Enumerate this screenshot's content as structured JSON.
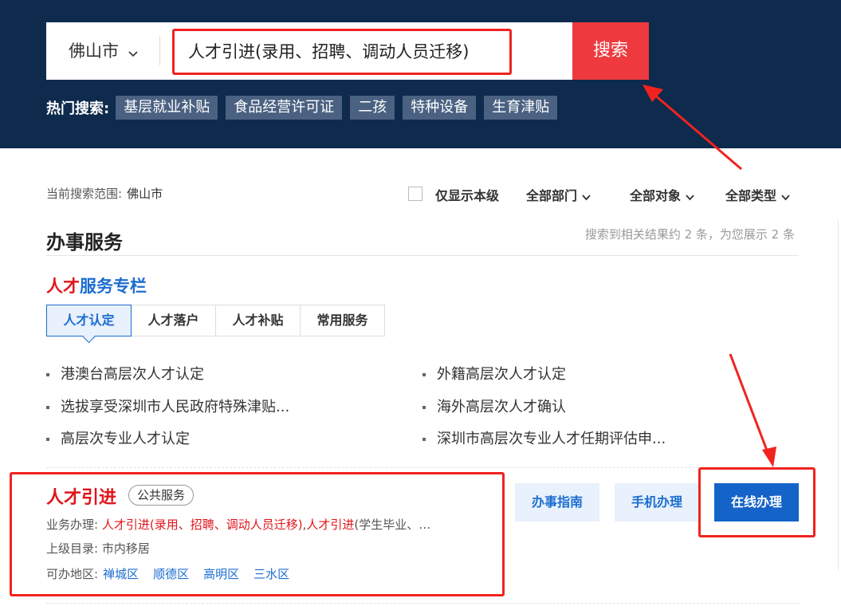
{
  "search": {
    "city": "佛山市",
    "query": "人才引进(录用、招聘、调动人员迁移)",
    "button": "搜索"
  },
  "hot": {
    "label": "热门搜索:",
    "tags": [
      "基层就业补贴",
      "食品经营许可证",
      "二孩",
      "特种设备",
      "生育津贴"
    ]
  },
  "filters": {
    "scope_label": "当前搜索范围:",
    "scope_value": "佛山市",
    "only_local": "仅显示本级",
    "dept": "全部部门",
    "target": "全部对象",
    "type": "全部类型"
  },
  "section": {
    "title": "办事服务",
    "count": "搜索到相关结果约 2 条，为您展示 2 条"
  },
  "column": {
    "title_red": "人才",
    "title_blue": "服务专栏",
    "tabs": [
      "人才认定",
      "人才落户",
      "人才补贴",
      "常用服务"
    ],
    "links": [
      "港澳台高层次人才认定",
      "外籍高层次人才认定",
      "选拔享受深圳市人民政府特殊津贴...",
      "海外高层次人才确认",
      "高层次专业人才认定",
      "深圳市高层次专业人才任期评估申..."
    ]
  },
  "result": {
    "title": "人才引进",
    "badge": "公共服务",
    "handle_label": "业务办理:",
    "handle_value_1": "人才引进(录用、招聘、调动人员迁移)",
    "handle_value_2": ",",
    "handle_value_3": "人才引进",
    "handle_value_4": "(学生毕业、…",
    "parent_label": "上级目录:",
    "parent_value": "市内移居",
    "area_label": "可办地区:",
    "areas": [
      "禅城区",
      "顺德区",
      "高明区",
      "三水区"
    ],
    "buttons": {
      "guide": "办事指南",
      "mobile": "手机办理",
      "online": "在线办理"
    }
  },
  "colors": {
    "header_bg": "#0e2a4d",
    "search_button": "#ee3a3e",
    "accent_blue": "#1463c9",
    "highlight_red": "#e0151b",
    "annotation": "#f1231f"
  }
}
